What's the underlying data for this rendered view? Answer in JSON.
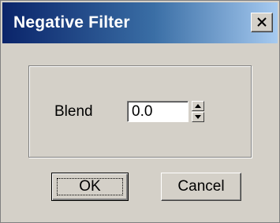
{
  "window": {
    "title": "Negative Filter",
    "close_icon": "close-icon"
  },
  "blend": {
    "label": "Blend",
    "value": "0.0",
    "spinner_up_icon": "arrow-up-icon",
    "spinner_down_icon": "arrow-down-icon"
  },
  "buttons": {
    "ok_label": "OK",
    "cancel_label": "Cancel"
  },
  "colors": {
    "title_gradient_start": "#0a246a",
    "title_gradient_end": "#a6caf0",
    "face": "#d4d0c8"
  }
}
